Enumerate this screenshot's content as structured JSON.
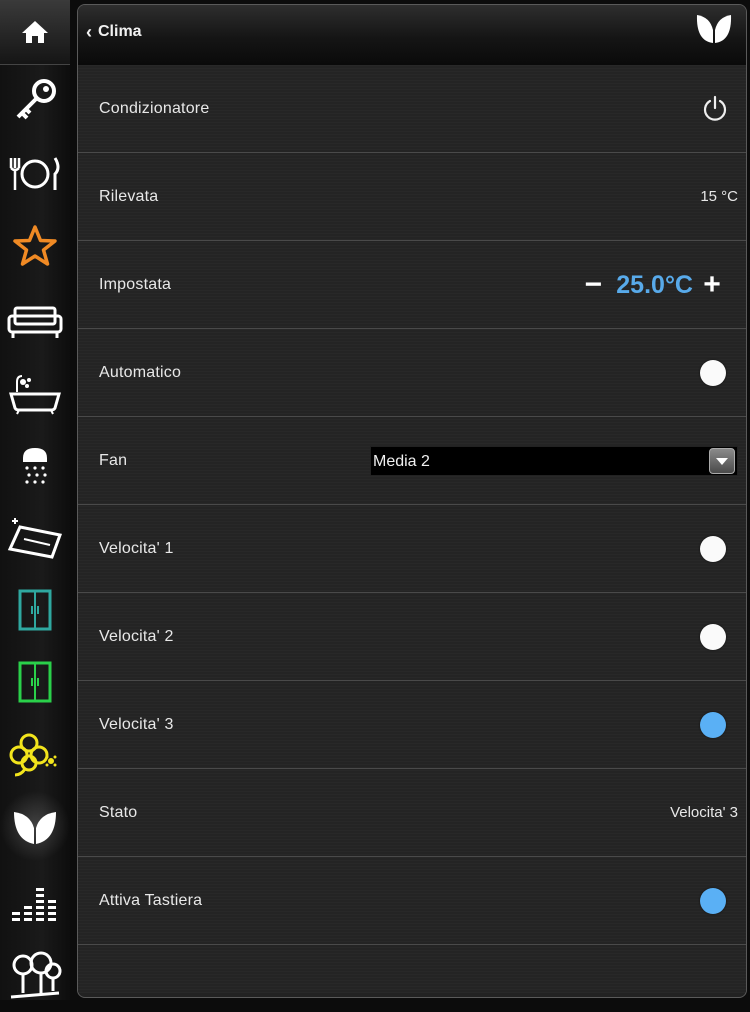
{
  "header": {
    "back_label": "Clima"
  },
  "sidebar": {
    "items": [
      {
        "name": "home-icon"
      },
      {
        "name": "key-icon"
      },
      {
        "name": "dining-icon"
      },
      {
        "name": "star-icon"
      },
      {
        "name": "sofa-icon"
      },
      {
        "name": "bathtub-icon"
      },
      {
        "name": "shower-icon"
      },
      {
        "name": "window-icon"
      },
      {
        "name": "door-icon"
      },
      {
        "name": "door-green-icon"
      },
      {
        "name": "flower-icon"
      },
      {
        "name": "leaf-icon",
        "active": true
      },
      {
        "name": "equalizer-icon"
      },
      {
        "name": "garden-icon"
      }
    ]
  },
  "colors": {
    "accent_blue": "#58aaea",
    "toggle_on": "#5ab0f5",
    "star_orange": "#f08a24",
    "teal": "#2fa8a0",
    "green": "#2ad04a",
    "yellow": "#f2e41c"
  },
  "rows": {
    "condizionatore": {
      "label": "Condizionatore",
      "icon": "power-icon"
    },
    "rilevata": {
      "label": "Rilevata",
      "value": "15 °C"
    },
    "impostata": {
      "label": "Impostata",
      "value": "25.0°C",
      "minus": "−",
      "plus": "+"
    },
    "automatico": {
      "label": "Automatico",
      "on": false
    },
    "fan": {
      "label": "Fan",
      "selected": "Media 2"
    },
    "velocita1": {
      "label": "Velocita' 1",
      "on": false
    },
    "velocita2": {
      "label": "Velocita' 2",
      "on": false
    },
    "velocita3": {
      "label": "Velocita' 3",
      "on": true
    },
    "stato": {
      "label": "Stato",
      "value": "Velocita' 3"
    },
    "attiva_tastiera": {
      "label": "Attiva Tastiera",
      "on": true
    }
  }
}
